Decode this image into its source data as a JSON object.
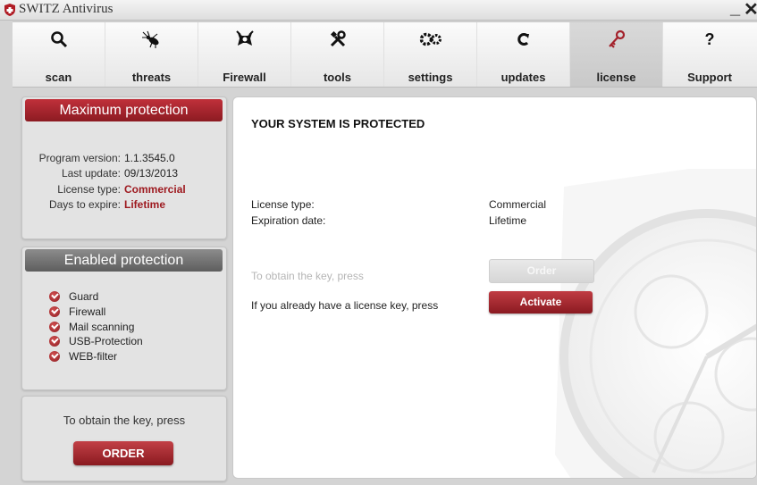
{
  "window": {
    "title": "SWITZ Antivirus",
    "minimize_label": "_",
    "close_label": "✕"
  },
  "toolbar": {
    "items": [
      {
        "label": "scan",
        "icon": "magnifier-icon"
      },
      {
        "label": "threats",
        "icon": "bug-icon"
      },
      {
        "label": "Firewall",
        "icon": "firewall-icon"
      },
      {
        "label": "tools",
        "icon": "tools-icon"
      },
      {
        "label": "settings",
        "icon": "gears-icon"
      },
      {
        "label": "updates",
        "icon": "refresh-icon"
      },
      {
        "label": "license",
        "icon": "key-icon",
        "active": true
      },
      {
        "label": "Support",
        "icon": "question-icon"
      }
    ]
  },
  "sidebar": {
    "status_panel": {
      "header": "Maximum protection",
      "rows": [
        {
          "label": "Program version:",
          "value": "1.1.3545.0"
        },
        {
          "label": "Last update:",
          "value": "09/13/2013"
        },
        {
          "label": "License type:",
          "value": "Commercial"
        },
        {
          "label": "Days to expire:",
          "value": "Lifetime"
        }
      ]
    },
    "protection_panel": {
      "header": "Enabled protection",
      "items": [
        "Guard",
        "Firewall",
        "Mail scanning",
        "USB-Protection",
        "WEB-filter"
      ]
    },
    "order_panel": {
      "text": "To obtain the key, press",
      "button": "ORDER"
    }
  },
  "main": {
    "title": "YOUR SYSTEM IS PROTECTED",
    "license_type_label": "License type:",
    "license_type_value": "Commercial",
    "expiration_label": "Expiration date:",
    "expiration_value": "Lifetime",
    "obtain_text": "To obtain the key, press",
    "order_button": "Order",
    "activate_text": "If you already have a license key, press",
    "activate_button": "Activate"
  },
  "colors": {
    "accent": "#9e1a20",
    "header_gray": "#6f6f6f",
    "panel_bg": "#e3e3e3"
  }
}
